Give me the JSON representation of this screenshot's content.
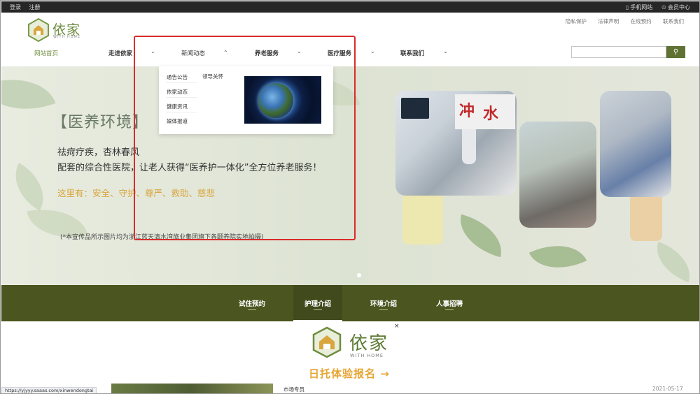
{
  "topbar": {
    "login": "登录",
    "register": "注册",
    "mobile_site": "手机网站",
    "member_center": "会员中心"
  },
  "header": {
    "logo_text": "依家",
    "logo_sub": "WITH HOME",
    "util_links": [
      "隐私保护",
      "法律声明",
      "在线预约",
      "联系我们"
    ]
  },
  "nav": {
    "items": [
      "网站首页",
      "走进依家",
      "新闻动态",
      "养老服务",
      "医疗服务",
      "联系我们"
    ],
    "search_placeholder": ""
  },
  "dropdown": {
    "items": [
      "通告公告",
      "依家动态",
      "健康资讯",
      "媒体报道"
    ],
    "right_item": "领导关怀"
  },
  "hero": {
    "title": "【医养环境】",
    "line1": "祛疴疗疾，杏林春风",
    "line2": "配套的综合性医院，让老人获得“医养护一体化”全方位养老服务！",
    "line3": "这里有：安全、守护、尊严、救助、慈悲",
    "note": "(*本宣传品所示图片均为浙江蓝天清水湾旅业集团旗下各颐养院实地拍摄)"
  },
  "subnav": {
    "items": [
      "试住预约",
      "护理介绍",
      "环境介绍",
      "人事招聘"
    ]
  },
  "popup": {
    "close": "×",
    "name": "依家",
    "sub": "WITH HOME",
    "cta": "日托体验报名 →"
  },
  "lower": {
    "label": "市场专员",
    "date": "2021-05-17"
  },
  "status_url": "https://yjyyy.saaas.com/xinwendongtai",
  "colors": {
    "brand_green": "#5f7233",
    "band_green": "#4a5520",
    "accent_orange": "#e6a532",
    "highlight_red": "#d92c2c"
  }
}
